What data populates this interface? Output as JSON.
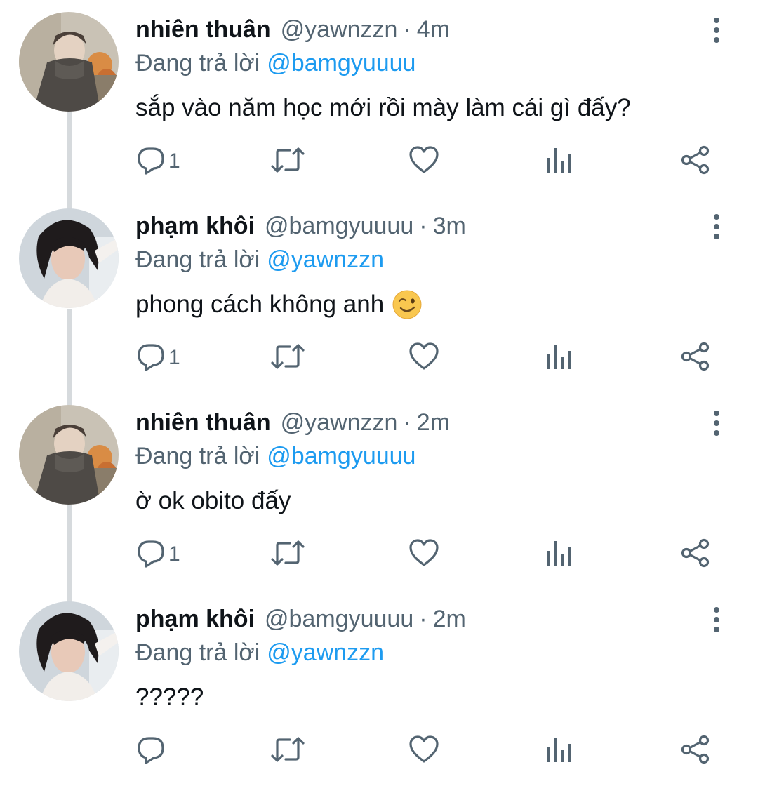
{
  "tweets": [
    {
      "display_name": "nhiên thuân",
      "handle": "@yawnzzn",
      "separator": "·",
      "time": "4m",
      "replying_prefix": "Đang trả lời",
      "replying_to": "@bamgyuuuu",
      "text": "sắp vào năm học mới rồi mày làm cái gì đấy?",
      "reply_count": "1",
      "avatar_icon": "avatar-photo-nhien-thuan"
    },
    {
      "display_name": "phạm khôi",
      "handle": "@bamgyuuuu",
      "separator": "·",
      "time": "3m",
      "replying_prefix": "Đang trả lời",
      "replying_to": "@yawnzzn",
      "text": "phong cách không anh",
      "emoji": "winking-face-emoji",
      "reply_count": "1",
      "avatar_icon": "avatar-photo-pham-khoi"
    },
    {
      "display_name": "nhiên thuân",
      "handle": "@yawnzzn",
      "separator": "·",
      "time": "2m",
      "replying_prefix": "Đang trả lời",
      "replying_to": "@bamgyuuuu",
      "text": "ờ ok obito đấy",
      "reply_count": "1",
      "avatar_icon": "avatar-photo-nhien-thuan"
    },
    {
      "display_name": "phạm khôi",
      "handle": "@bamgyuuuu",
      "separator": "·",
      "time": "2m",
      "replying_prefix": "Đang trả lời",
      "replying_to": "@yawnzzn",
      "text": "?????",
      "reply_count": "",
      "avatar_icon": "avatar-photo-pham-khoi"
    }
  ],
  "colors": {
    "text_primary": "#0f1419",
    "text_secondary": "#536471",
    "link": "#1d9bf0",
    "thread_line": "#d6dadd"
  }
}
